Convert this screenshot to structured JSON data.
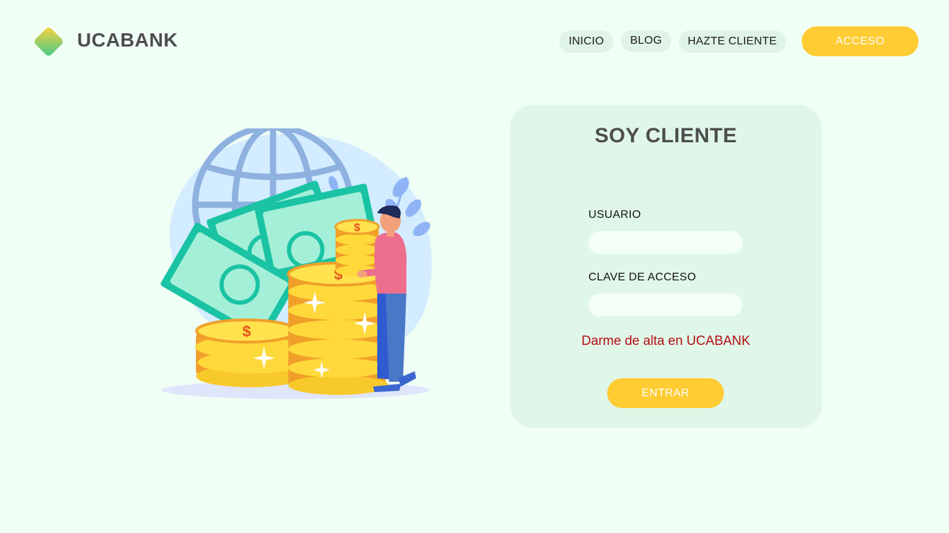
{
  "header": {
    "brand_name": "UCABANK",
    "logo_icon": "diamond-logo-icon",
    "nav": {
      "inicio": "INICIO",
      "blog": "BLOG",
      "hazte_cliente": "HAZTE CLIENTE"
    },
    "acceso_label": "ACCESO"
  },
  "login": {
    "title": "SOY CLIENTE",
    "usuario_label": "USUARIO",
    "usuario_value": "",
    "clave_label": "CLAVE DE ACCESO",
    "clave_value": "",
    "signup_link": "Darme de alta en UCABANK",
    "submit_label": "ENTRAR"
  },
  "illustration": {
    "icon": "money-coins-globe-illustration"
  },
  "colors": {
    "background": "#f0fff5",
    "accent_yellow": "#ffcc33",
    "card_bg": "#e0f6e9",
    "link_red": "#b30e12",
    "brand_text": "#4d4d4d"
  }
}
